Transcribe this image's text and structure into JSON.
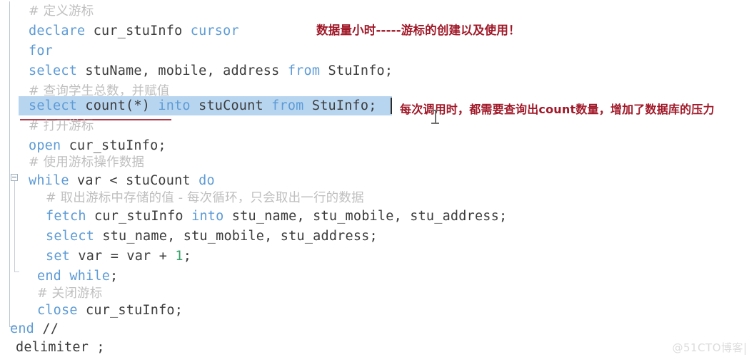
{
  "editor": {
    "language": "sql",
    "background": "#ffffff",
    "keyword_color": "#5d9bd6",
    "identifier_color": "#3c3c3c",
    "comment_color": "#bfbfbf",
    "number_color": "#37a06a",
    "selection_color": "#b8d5f0",
    "error_underline_color": "#b03a4a",
    "lines": [
      {
        "indent": 1,
        "text": "# 定义游标"
      },
      {
        "indent": 1,
        "text": "declare cur_stuInfo cursor"
      },
      {
        "indent": 1,
        "text": "for"
      },
      {
        "indent": 1,
        "text": "select stuName, mobile, address from StuInfo;"
      },
      {
        "indent": 1,
        "text": "# 查询学生总数，并赋值"
      },
      {
        "indent": 1,
        "text": "select count(*) into stuCount from StuInfo;"
      },
      {
        "indent": 1,
        "text": "# 打开游标"
      },
      {
        "indent": 1,
        "text": "open cur_stuInfo;"
      },
      {
        "indent": 1,
        "text": "# 使用游标操作数据"
      },
      {
        "indent": 1,
        "text": "while var < stuCount do"
      },
      {
        "indent": 2,
        "text": "# 取出游标中存储的值 - 每次循环，只会取出一行的数据"
      },
      {
        "indent": 2,
        "text": "fetch cur_stuInfo into stu_name, stu_mobile, stu_address;"
      },
      {
        "indent": 2,
        "text": "select stu_name, stu_mobile, stu_address;"
      },
      {
        "indent": 2,
        "text": "set var = var + 1;"
      },
      {
        "indent": 1,
        "text": "end while;"
      },
      {
        "indent": 1,
        "text": "# 关闭游标"
      },
      {
        "indent": 1,
        "text": "close cur_stuInfo;"
      },
      {
        "indent": 0,
        "text": "end //"
      },
      {
        "indent": 0,
        "text": "delimiter ;"
      }
    ],
    "tokens": {
      "l1_comment": "# 定义游标",
      "l2_kw_declare": "declare",
      "l2_id_cursor_name": " cur_stuInfo ",
      "l2_kw_cursor": "cursor",
      "l3_kw_for": "for",
      "l4_kw_select": "select",
      "l4_cols": " stuName, mobile, address ",
      "l4_kw_from": "from",
      "l4_table": " StuInfo;",
      "l5_comment": "# 查询学生总数，并赋值",
      "l6_kw_select": "select",
      "l6_count": " count(*) ",
      "l6_kw_into": "into",
      "l6_var": " stuCount ",
      "l6_kw_from": "from",
      "l6_table": " StuInfo;",
      "l7_comment": "# 打开游标",
      "l8_kw_open": "open",
      "l8_id": " cur_stuInfo;",
      "l9_comment": "# 使用游标操作数据",
      "l10_kw_while": "while",
      "l10_cond": " var < stuCount ",
      "l10_kw_do": "do",
      "l11_comment": "# 取出游标中存储的值 - 每次循环，只会取出一行的数据",
      "l12_kw_fetch": "fetch",
      "l12_id": " cur_stuInfo ",
      "l12_kw_into": "into",
      "l12_vars": " stu_name, stu_mobile, stu_address;",
      "l13_kw_select": "select",
      "l13_vars": " stu_name, stu_mobile, stu_address;",
      "l14_kw_set": "set",
      "l14_expr": " var = var + ",
      "l14_num": "1",
      "l14_semi": ";",
      "l15_kw_end_while": "end while",
      "l15_semi": ";",
      "l16_comment": "# 关闭游标",
      "l17_kw_close": "close",
      "l17_id": " cur_stuInfo;",
      "l18_kw_end": "end",
      "l18_slashes": " //",
      "l19_text": "delimiter ;"
    }
  },
  "annotations": {
    "title": "数据量小时-----游标的创建以及使用！",
    "note": "每次调用时，都需要查询出count数量，增加了数据库的压力",
    "color": "#a01828"
  },
  "watermark": {
    "text": "@51CTO博客"
  }
}
